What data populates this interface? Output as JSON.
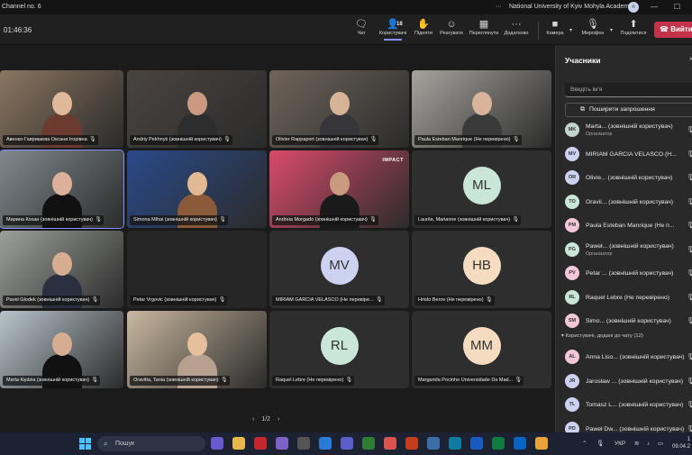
{
  "titlebar": {
    "window_title": "Channel no. 6",
    "org": "National University of Kyiv Mohyla Academy",
    "avatar": "n",
    "more": "···",
    "minimize": "—",
    "maximize": "☐"
  },
  "toolbar": {
    "timer": "01:46:36",
    "chat": "Чат",
    "people": "Користувачі",
    "people_count": "18",
    "raise": "Підняти",
    "react": "Реагувати",
    "view": "Переглянути",
    "apps": "Додатково",
    "camera": "Камера",
    "mic": "Мікрофон",
    "share": "Поділитися",
    "leave": "Вийти"
  },
  "tiles": [
    {
      "name": "Авенко-Гавришева Оксана Ігорівна",
      "type": "video",
      "bg": "#8a7560",
      "face": "#e0b89a",
      "shirt": "#6a3b2e"
    },
    {
      "name": "Andriy Pekhnyk (зовнішній користувач)",
      "type": "video",
      "bg": "#4a4440",
      "face": "#c99a80",
      "shirt": "#2d2d2d"
    },
    {
      "name": "Olivier Rappaport (зовнішній користувач)",
      "type": "video",
      "bg": "#6e655a",
      "face": "#d7b498",
      "shirt": "#36353a"
    },
    {
      "name": "Paula Esteban Manrique (Не перевірено)",
      "type": "video",
      "bg": "#a5a39d",
      "face": "#d9b49a",
      "shirt": "#3a3a3a"
    },
    {
      "name": "Марина Кохан (зовнішній користувач)",
      "type": "video",
      "bg": "#7f8a8e",
      "face": "#dcb09a",
      "shirt": "#111111",
      "selected": true
    },
    {
      "name": "Simona Mihai (зовнішній користувач)",
      "type": "video",
      "bg": "#2a4a8a",
      "face": "#e1b992",
      "shirt": "#8a5a3a"
    },
    {
      "name": "Andreia Morgado (зовнішній користувач)",
      "type": "video",
      "bg": "#d94a6a",
      "face": "#c99a80",
      "shirt": "#1a1a1a",
      "impact": "IMPACT"
    },
    {
      "name": "Laurila, Marianne (зовнішній користувач)",
      "type": "avatar",
      "initials": "ML",
      "color": "#c9e6d8"
    },
    {
      "name": "Pavel Głodek (зовнішній користувач)",
      "type": "video",
      "bg": "#9ca09a",
      "face": "#d6ad90",
      "shirt": "#2a3040"
    },
    {
      "name": "Petar Vrgovic (зовнішній користувач)",
      "type": "blank"
    },
    {
      "name": "MIRIAM GARCIA VELASCO (Не перевіре...",
      "type": "avatar",
      "initials": "MV",
      "color": "#ccd2f0"
    },
    {
      "name": "Hristo Berov (Не перевірено)",
      "type": "avatar",
      "initials": "HB",
      "color": "#f5dcc0"
    },
    {
      "name": "Marta Kędzia (зовнішній користувач)",
      "type": "video",
      "bg": "#b8c4cc",
      "face": "#d6ad90",
      "shirt": "#111111"
    },
    {
      "name": "Oravilta, Tania (зовнішній користувач)",
      "type": "video",
      "bg": "#c9b8a0",
      "face": "#e6c09c",
      "shirt": "#b8a090"
    },
    {
      "name": "Raquel Lebre (Не перевірено)",
      "type": "avatar",
      "initials": "RL",
      "color": "#c9e6d8"
    },
    {
      "name": "Margarida Pocinho Universidade Da Mad...",
      "type": "avatar",
      "initials": "MM",
      "color": "#f5dcc0"
    }
  ],
  "pager": {
    "prev": "‹",
    "label": "1/2",
    "next": "›"
  },
  "panel": {
    "title": "Учасники",
    "close": "×",
    "search_placeholder": "Введіть ім'я",
    "invite": "Поширити запрошення",
    "participants": [
      {
        "initials": "MK",
        "color": "#c5d3ce",
        "name": "Marta... (зовнішній користувач)",
        "role": "Організатор"
      },
      {
        "initials": "MV",
        "color": "#ccd2f0",
        "name": "MIRIAM GARCIA VELASCO (H...",
        "role": ""
      },
      {
        "initials": "OR",
        "color": "#ccd2f0",
        "name": "Olivie... (зовнішній користувач)",
        "role": ""
      },
      {
        "initials": "TO",
        "color": "#c9e6d8",
        "name": "Oravii... (зовнішній користувач)",
        "role": ""
      },
      {
        "initials": "PM",
        "color": "#f3c7d8",
        "name": "Paula Esteban Manrique (Не п...",
        "role": ""
      },
      {
        "initials": "PG",
        "color": "#c9e6d8",
        "name": "Paweł... (зовнішній користувач)",
        "role": "Організатор"
      },
      {
        "initials": "PV",
        "color": "#f3c7d8",
        "name": "Petar ... (зовнішній користувач)",
        "role": ""
      },
      {
        "initials": "RL",
        "color": "#c9e6d8",
        "name": "Raquel Lebre (Не перевірено)",
        "role": ""
      },
      {
        "initials": "SM",
        "color": "#f3c7d8",
        "name": "Simo... (зовнішній користувач)",
        "role": ""
      }
    ],
    "section": "Користувачі, додані до чату (12)",
    "chat_users": [
      {
        "initials": "AL",
        "color": "#f3c7d8",
        "name": "Anna Liso... (зовнішній користувач)"
      },
      {
        "initials": "JR",
        "color": "#ccd2f0",
        "name": "Jarosław ... (зовнішній користувач)"
      },
      {
        "initials": "TL",
        "color": "#ccd2f0",
        "name": "Tomasz L... (зовнішній користувач)"
      },
      {
        "initials": "PD",
        "color": "#ccd2f0",
        "name": "Paweł Dw... (зовнішній користувач)"
      }
    ]
  },
  "taskbar": {
    "search": "Пошук",
    "lang": "УКР",
    "time": "1",
    "date": "09.04.2"
  }
}
